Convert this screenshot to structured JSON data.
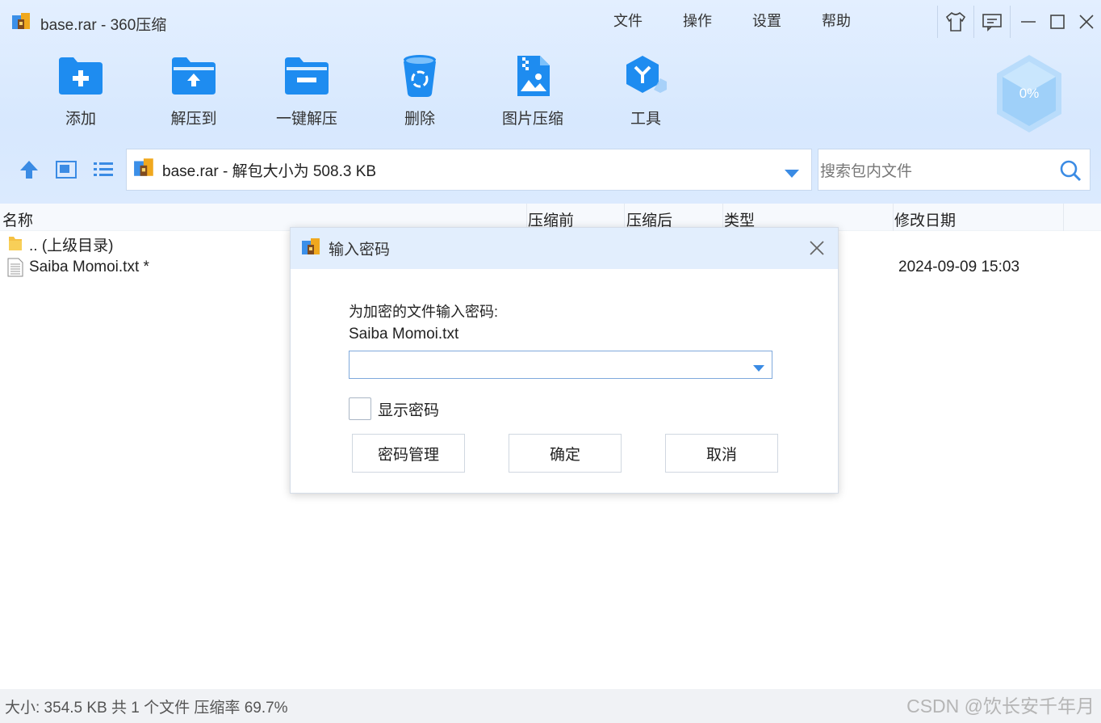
{
  "window": {
    "title": "base.rar - 360压缩"
  },
  "menu": [
    "文件",
    "操作",
    "设置",
    "帮助"
  ],
  "toolbar": [
    {
      "label": "添加",
      "icon": "folder-add-icon"
    },
    {
      "label": "解压到",
      "icon": "folder-extract-icon"
    },
    {
      "label": "一键解压",
      "icon": "folder-quick-extract-icon"
    },
    {
      "label": "删除",
      "icon": "recycle-bin-icon"
    },
    {
      "label": "图片压缩",
      "icon": "image-compress-icon"
    },
    {
      "label": "工具",
      "icon": "tools-icon"
    }
  ],
  "gauge": {
    "text": "0%"
  },
  "path": {
    "text": "base.rar - 解包大小为 508.3 KB"
  },
  "search": {
    "placeholder": "搜索包内文件"
  },
  "columns": {
    "name": "名称",
    "before": "压缩前",
    "after": "压缩后",
    "type": "类型",
    "modified": "修改日期"
  },
  "files": [
    {
      "name": ".. (上级目录)",
      "icon": "folder-icon",
      "date": ""
    },
    {
      "name": "Saiba Momoi.txt *",
      "icon": "text-file-icon",
      "date": "2024-09-09 15:03"
    }
  ],
  "status": {
    "text": "大小: 354.5 KB 共 1 个文件 压缩率 69.7%"
  },
  "watermark": "CSDN @饮长安千年月",
  "dialog": {
    "title": "输入密码",
    "prompt": "为加密的文件输入密码:",
    "filename": "Saiba Momoi.txt",
    "password_value": "",
    "show_password_label": "显示密码",
    "buttons": {
      "manage": "密码管理",
      "ok": "确定",
      "cancel": "取消"
    }
  },
  "colors": {
    "accent": "#2a8ff0",
    "topbar": "#dbeafe",
    "dialog_header": "#e2eefd"
  }
}
